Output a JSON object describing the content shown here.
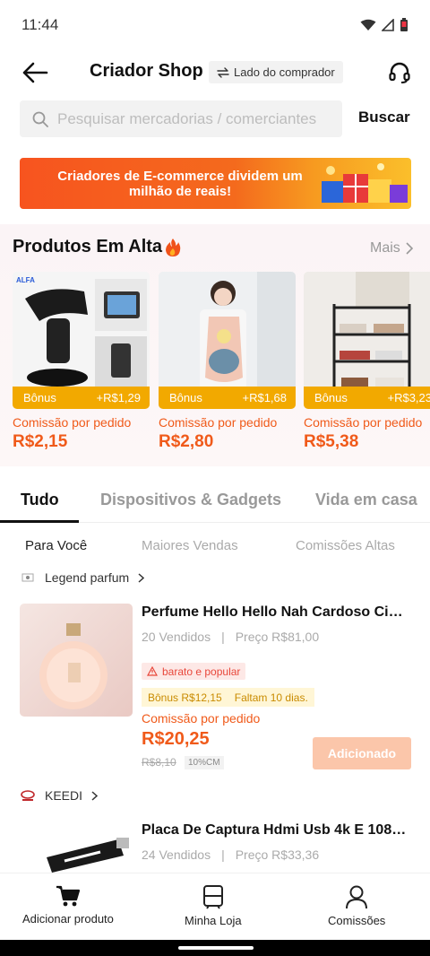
{
  "status_bar": {
    "time": "11:44"
  },
  "header": {
    "title": "Criador Shop",
    "switch_label": "Lado do comprador"
  },
  "search": {
    "placeholder": "Pesquisar mercadorias / comerciantes",
    "button_label": "Buscar"
  },
  "banner": {
    "text": "Criadores de E-commerce dividem um milhão de reais!"
  },
  "hot_products": {
    "title": "Produtos Em Alta",
    "more_label": "Mais",
    "items": [
      {
        "brand": "ALFA",
        "bonus_label": "Bônus",
        "bonus_value": "+R$1,29",
        "commission_label": "Comissão por pedido",
        "commission_value": "R$2,15"
      },
      {
        "bonus_label": "Bônus",
        "bonus_value": "+R$1,68",
        "commission_label": "Comissão por pedido",
        "commission_value": "R$2,80"
      },
      {
        "bonus_label": "Bônus",
        "bonus_value": "+R$3,23",
        "commission_label": "Comissão por pedido",
        "commission_value": "R$5,38"
      }
    ]
  },
  "tabs": [
    "Tudo",
    "Dispositivos & Gadgets",
    "Vida em casa"
  ],
  "subtabs": [
    "Para Você",
    "Maiores Vendas",
    "Comissões Altas"
  ],
  "feed": [
    {
      "shop_name": "Legend parfum",
      "title": "Perfume Hello Hello Nah Cardoso Ciclo...",
      "sold": "20 Vendidos",
      "price": "Preço R$81,00",
      "tag": "barato e popular",
      "bonus": "Bônus R$12,15",
      "remaining": "Faltam 10 dias.",
      "commission_label": "Comissão por pedido",
      "commission_value": "R$20,25",
      "old_price": "R$8,10",
      "cm_badge": "10%CM",
      "button_label": "Adicionado"
    },
    {
      "shop_name": "KEEDI",
      "title": "Placa De Captura Hdmi Usb 4k E 1080p...",
      "sold": "24 Vendidos",
      "price": "Preço R$33,36"
    }
  ],
  "bottom_nav": [
    "Adicionar produto",
    "Minha Loja",
    "Comissões"
  ],
  "colors": {
    "accent": "#f05a1a",
    "bonus": "#f2a900",
    "added_button": "#fbc6aa"
  }
}
